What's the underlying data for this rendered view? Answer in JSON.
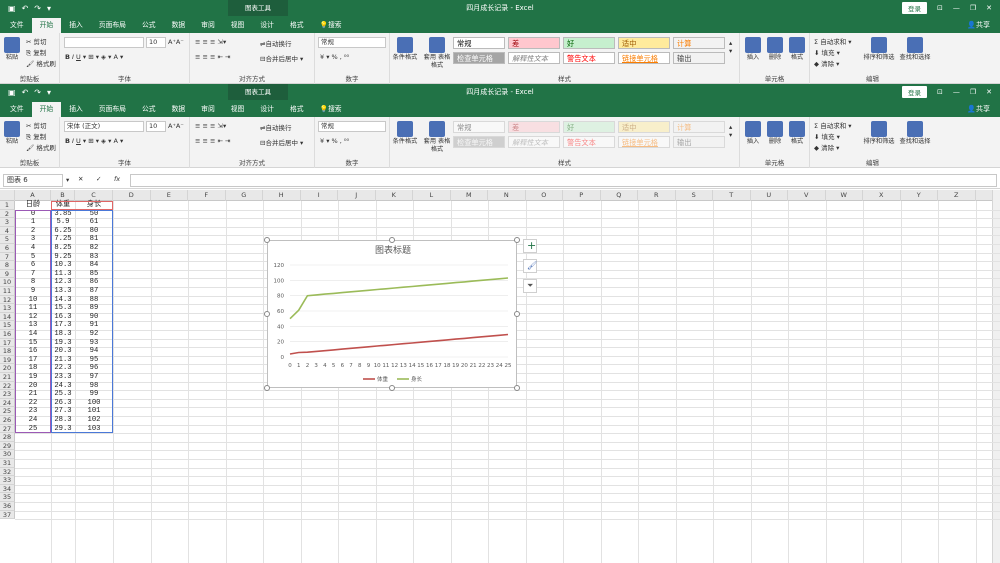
{
  "window": {
    "title": "四月成长记录 - Excel",
    "context_tab": "图表工具",
    "login": "登录",
    "share": "共享"
  },
  "tabs": [
    "文件",
    "开始",
    "插入",
    "页面布局",
    "公式",
    "数据",
    "审阅",
    "视图",
    "设计",
    "格式",
    "搜索"
  ],
  "active_tab": "开始",
  "ribbon": {
    "clipboard": {
      "paste": "粘贴",
      "cut": "剪切",
      "copy": "复制",
      "format_painter": "格式刷",
      "label": "剪贴板"
    },
    "font": {
      "name": "宋体 (正文)",
      "size": "10",
      "label": "字体"
    },
    "alignment": {
      "wrap": "自动换行",
      "merge": "合并后居中",
      "label": "对齐方式"
    },
    "number": {
      "format": "常规",
      "label": "数字"
    },
    "styles": {
      "cond_format": "条件格式",
      "table_format": "套用\n表格格式",
      "items": [
        {
          "text": "常规",
          "bg": "#ffffff",
          "color": "#000000"
        },
        {
          "text": "差",
          "bg": "#ffc7ce",
          "color": "#9c0006"
        },
        {
          "text": "好",
          "bg": "#c6efce",
          "color": "#006100"
        },
        {
          "text": "适中",
          "bg": "#ffeb9c",
          "color": "#9c5700"
        },
        {
          "text": "计算",
          "bg": "#f2f2f2",
          "color": "#fa7d00"
        },
        {
          "text": "检查单元格",
          "bg": "#a5a5a5",
          "color": "#ffffff"
        },
        {
          "text": "解释性文本",
          "bg": "#ffffff",
          "color": "#7f7f7f"
        },
        {
          "text": "警告文本",
          "bg": "#ffffff",
          "color": "#ff0000"
        },
        {
          "text": "链接单元格",
          "bg": "#ffffff",
          "color": "#fa7d00"
        },
        {
          "text": "输出",
          "bg": "#f2f2f2",
          "color": "#3f3f3f"
        }
      ],
      "label": "样式"
    },
    "cells": {
      "insert": "插入",
      "delete": "删除",
      "format": "格式",
      "label": "单元格"
    },
    "editing": {
      "autosum": "自动求和",
      "fill": "填充",
      "clear": "清除",
      "sort": "排序和筛选",
      "find": "查找和选择",
      "label": "编辑"
    }
  },
  "formula_bar": {
    "name_box": "图表 6",
    "fx": "fx"
  },
  "sheet": {
    "columns": [
      "A",
      "B",
      "C",
      "D",
      "E",
      "F",
      "G",
      "H",
      "I",
      "J",
      "K",
      "L",
      "M",
      "N",
      "O",
      "P",
      "Q",
      "R",
      "S",
      "T",
      "U",
      "V",
      "W",
      "X",
      "Y",
      "Z"
    ],
    "header": [
      "日龄",
      "体重",
      "身长"
    ],
    "rows": [
      [
        "0",
        "3.85",
        "50"
      ],
      [
        "1",
        "5.9",
        "61"
      ],
      [
        "2",
        "6.25",
        "80"
      ],
      [
        "3",
        "7.25",
        "81"
      ],
      [
        "4",
        "8.25",
        "82"
      ],
      [
        "5",
        "9.25",
        "83"
      ],
      [
        "6",
        "10.3",
        "84"
      ],
      [
        "7",
        "11.3",
        "85"
      ],
      [
        "8",
        "12.3",
        "86"
      ],
      [
        "9",
        "13.3",
        "87"
      ],
      [
        "10",
        "14.3",
        "88"
      ],
      [
        "11",
        "15.3",
        "89"
      ],
      [
        "12",
        "16.3",
        "90"
      ],
      [
        "13",
        "17.3",
        "91"
      ],
      [
        "14",
        "18.3",
        "92"
      ],
      [
        "15",
        "19.3",
        "93"
      ],
      [
        "16",
        "20.3",
        "94"
      ],
      [
        "17",
        "21.3",
        "95"
      ],
      [
        "18",
        "22.3",
        "96"
      ],
      [
        "19",
        "23.3",
        "97"
      ],
      [
        "20",
        "24.3",
        "98"
      ],
      [
        "21",
        "25.3",
        "99"
      ],
      [
        "22",
        "26.3",
        "100"
      ],
      [
        "23",
        "27.3",
        "101"
      ],
      [
        "24",
        "28.3",
        "102"
      ],
      [
        "25",
        "29.3",
        "103"
      ]
    ],
    "row_count": 37
  },
  "chart_data": {
    "type": "line",
    "title": "图表标题",
    "x": [
      0,
      1,
      2,
      3,
      4,
      5,
      6,
      7,
      8,
      9,
      10,
      11,
      12,
      13,
      14,
      15,
      16,
      17,
      18,
      19,
      20,
      21,
      22,
      23,
      24,
      25
    ],
    "series": [
      {
        "name": "体重",
        "color": "#c0504d",
        "values": [
          3.85,
          5.9,
          6.25,
          7.25,
          8.25,
          9.25,
          10.3,
          11.3,
          12.3,
          13.3,
          14.3,
          15.3,
          16.3,
          17.3,
          18.3,
          19.3,
          20.3,
          21.3,
          22.3,
          23.3,
          24.3,
          25.3,
          26.3,
          27.3,
          28.3,
          29.3
        ]
      },
      {
        "name": "身长",
        "color": "#9bbb59",
        "values": [
          50,
          61,
          80,
          81,
          82,
          83,
          84,
          85,
          86,
          87,
          88,
          89,
          90,
          91,
          92,
          93,
          94,
          95,
          96,
          97,
          98,
          99,
          100,
          101,
          102,
          103
        ]
      }
    ],
    "ylim": [
      0,
      120
    ],
    "yticks": [
      "0",
      "20",
      "40",
      "60",
      "80",
      "100",
      "120"
    ],
    "legend": "bottom",
    "grid": true
  }
}
